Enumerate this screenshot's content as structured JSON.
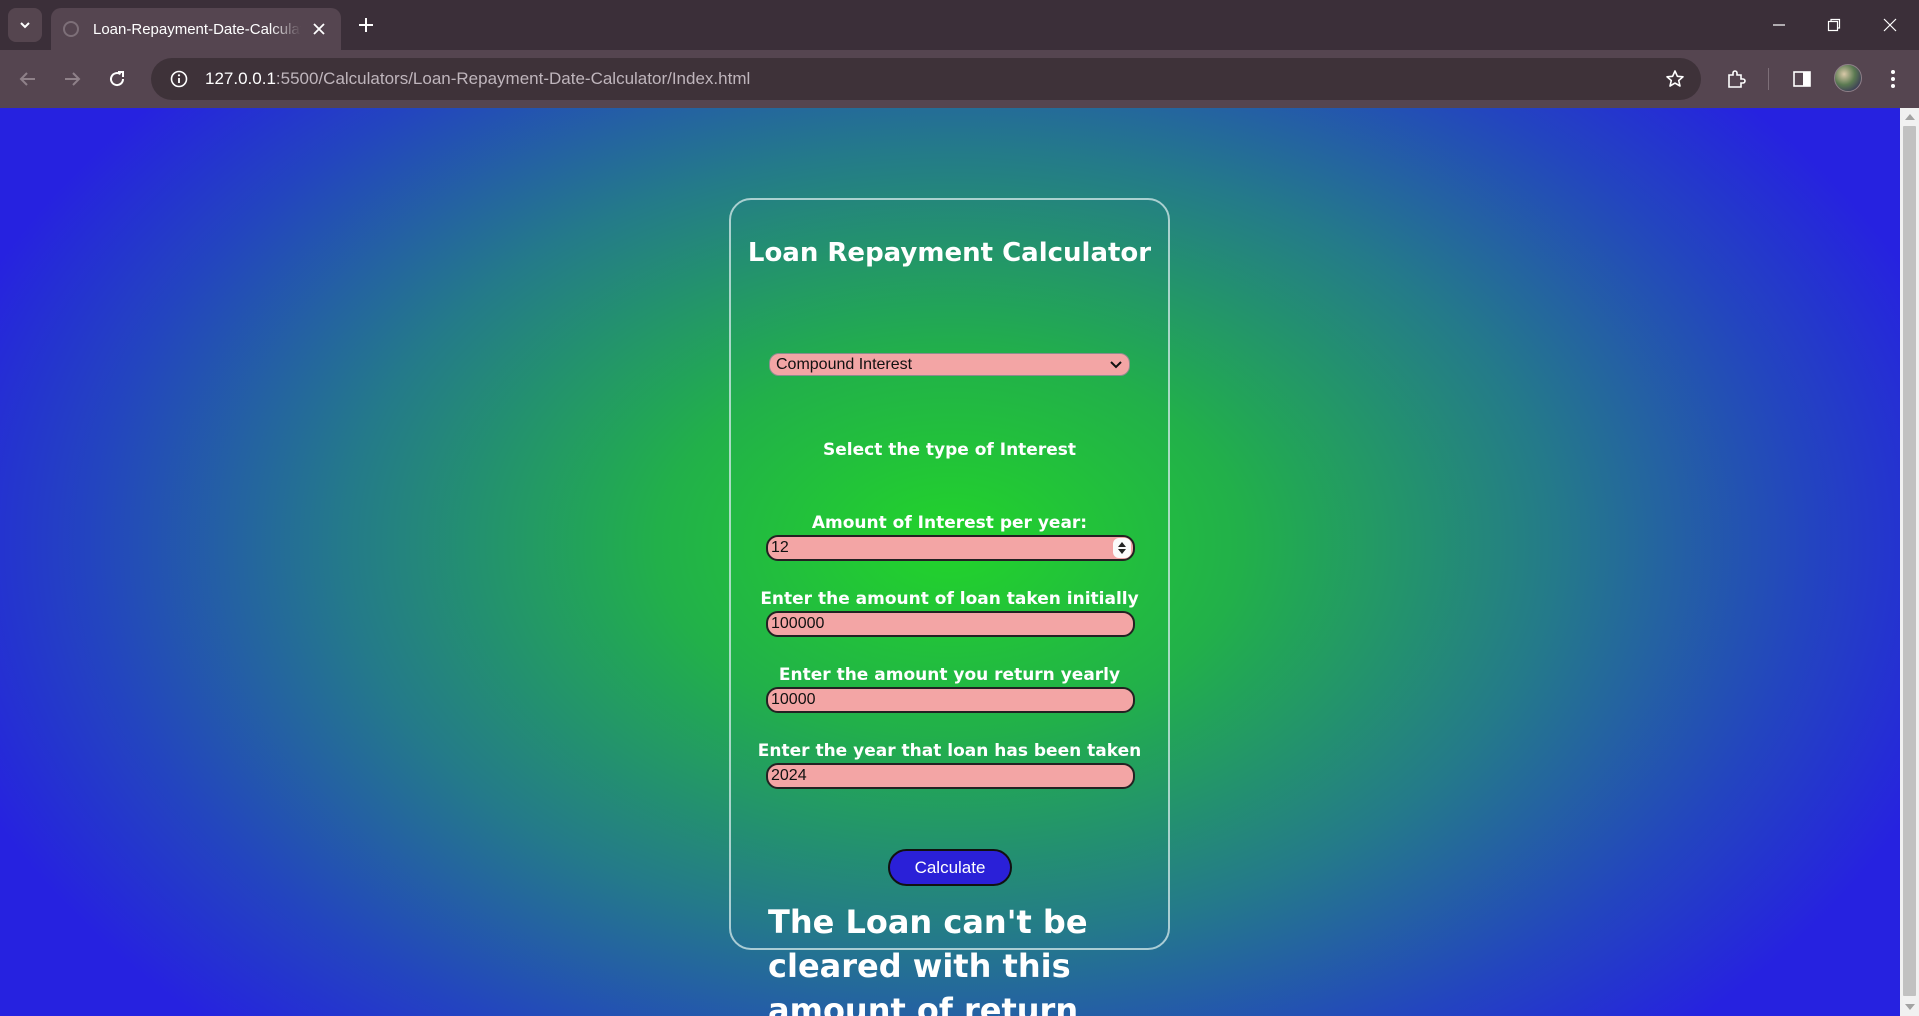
{
  "browser": {
    "tab_title": "Loan-Repayment-Date-Calculator",
    "url_host": "127.0.0.1",
    "url_rest": ":5500/Calculators/Loan-Repayment-Date-Calculator/Index.html"
  },
  "page": {
    "title": "Loan Repayment Calculator",
    "interest_type_label": "Select the type of Interest",
    "interest_type_value": "Compound Interest",
    "interest_rate_label": "Amount of Interest per year:",
    "interest_rate_value": "12",
    "loan_amount_label": "Enter the amount of loan taken initially",
    "loan_amount_value": "100000",
    "yearly_return_label": "Enter the amount you return yearly",
    "yearly_return_value": "10000",
    "loan_year_label": "Enter the year that loan has been taken",
    "loan_year_value": "2024",
    "calculate_label": "Calculate",
    "result_text": "The Loan can't be cleared with this amount of return"
  },
  "colors": {
    "gradient_center": "#22d42a",
    "gradient_edge": "#2622e0",
    "input_fill": "#f3a5a5",
    "button_fill": "#2a20d8"
  },
  "icons": [
    "tab-search-icon",
    "favicon-icon",
    "close-icon",
    "plus-icon",
    "minimize-icon",
    "restore-icon",
    "back-arrow-icon",
    "forward-arrow-icon",
    "reload-icon",
    "site-info-icon",
    "star-icon",
    "extensions-icon",
    "side-panel-icon",
    "menu-dots-icon",
    "chevron-down-icon"
  ]
}
